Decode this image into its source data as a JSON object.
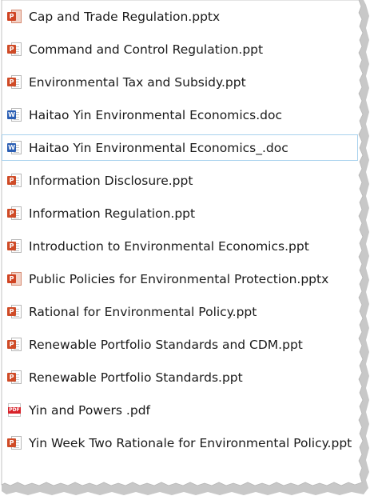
{
  "files": [
    {
      "name": "Cap and Trade Regulation.pptx",
      "type": "pptx",
      "icon": "powerpoint-pptx-icon",
      "selected": false
    },
    {
      "name": "Command and Control Regulation.ppt",
      "type": "ppt",
      "icon": "powerpoint-ppt-icon",
      "selected": false
    },
    {
      "name": "Environmental Tax and Subsidy.ppt",
      "type": "ppt",
      "icon": "powerpoint-ppt-icon",
      "selected": false
    },
    {
      "name": "Haitao Yin Environmental Economics.doc",
      "type": "doc",
      "icon": "word-doc-icon",
      "selected": false
    },
    {
      "name": "Haitao Yin Environmental Economics_.doc",
      "type": "doc",
      "icon": "word-doc-icon",
      "selected": true
    },
    {
      "name": "Information Disclosure.ppt",
      "type": "ppt",
      "icon": "powerpoint-ppt-icon",
      "selected": false
    },
    {
      "name": "Information Regulation.ppt",
      "type": "ppt",
      "icon": "powerpoint-ppt-icon",
      "selected": false
    },
    {
      "name": "Introduction to Environmental Economics.ppt",
      "type": "ppt",
      "icon": "powerpoint-ppt-icon",
      "selected": false
    },
    {
      "name": "Public Policies for Environmental Protection.pptx",
      "type": "pptx",
      "icon": "powerpoint-pptx-icon",
      "selected": false
    },
    {
      "name": "Rational for Environmental Policy.ppt",
      "type": "ppt",
      "icon": "powerpoint-ppt-icon",
      "selected": false
    },
    {
      "name": "Renewable Portfolio Standards and CDM.ppt",
      "type": "ppt",
      "icon": "powerpoint-ppt-icon",
      "selected": false
    },
    {
      "name": "Renewable Portfolio Standards.ppt",
      "type": "ppt",
      "icon": "powerpoint-ppt-icon",
      "selected": false
    },
    {
      "name": "Yin and Powers .pdf",
      "type": "pdf",
      "icon": "pdf-icon",
      "selected": false
    },
    {
      "name": "Yin Week Two Rationale for Environmental Policy.ppt",
      "type": "ppt",
      "icon": "powerpoint-ppt-icon",
      "selected": false
    }
  ],
  "colors": {
    "selection_border": "#a9d2ee",
    "ppt_badge": "#cf4b27",
    "pptx_badge": "#d04423",
    "word_badge": "#2b5fb4",
    "pdf_band": "#d8222a",
    "text": "#1a1a1a"
  },
  "badge_letters": {
    "ppt": "P",
    "pptx": "P",
    "doc": "W",
    "pdf": "PDF"
  }
}
